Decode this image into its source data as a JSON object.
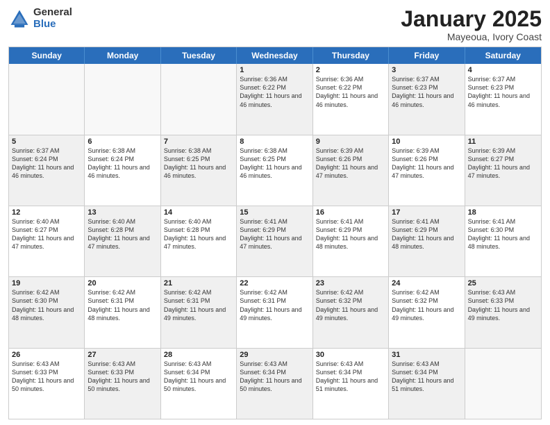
{
  "header": {
    "logo_general": "General",
    "logo_blue": "Blue",
    "title": "January 2025",
    "location": "Mayeoua, Ivory Coast"
  },
  "weekdays": [
    "Sunday",
    "Monday",
    "Tuesday",
    "Wednesday",
    "Thursday",
    "Friday",
    "Saturday"
  ],
  "rows": [
    [
      {
        "day": "",
        "info": "",
        "empty": true
      },
      {
        "day": "",
        "info": "",
        "empty": true
      },
      {
        "day": "",
        "info": "",
        "empty": true
      },
      {
        "day": "1",
        "info": "Sunrise: 6:36 AM\nSunset: 6:22 PM\nDaylight: 11 hours and 46 minutes.",
        "shaded": true
      },
      {
        "day": "2",
        "info": "Sunrise: 6:36 AM\nSunset: 6:22 PM\nDaylight: 11 hours and 46 minutes."
      },
      {
        "day": "3",
        "info": "Sunrise: 6:37 AM\nSunset: 6:23 PM\nDaylight: 11 hours and 46 minutes.",
        "shaded": true
      },
      {
        "day": "4",
        "info": "Sunrise: 6:37 AM\nSunset: 6:23 PM\nDaylight: 11 hours and 46 minutes."
      }
    ],
    [
      {
        "day": "5",
        "info": "Sunrise: 6:37 AM\nSunset: 6:24 PM\nDaylight: 11 hours and 46 minutes.",
        "shaded": true
      },
      {
        "day": "6",
        "info": "Sunrise: 6:38 AM\nSunset: 6:24 PM\nDaylight: 11 hours and 46 minutes."
      },
      {
        "day": "7",
        "info": "Sunrise: 6:38 AM\nSunset: 6:25 PM\nDaylight: 11 hours and 46 minutes.",
        "shaded": true
      },
      {
        "day": "8",
        "info": "Sunrise: 6:38 AM\nSunset: 6:25 PM\nDaylight: 11 hours and 46 minutes."
      },
      {
        "day": "9",
        "info": "Sunrise: 6:39 AM\nSunset: 6:26 PM\nDaylight: 11 hours and 47 minutes.",
        "shaded": true
      },
      {
        "day": "10",
        "info": "Sunrise: 6:39 AM\nSunset: 6:26 PM\nDaylight: 11 hours and 47 minutes."
      },
      {
        "day": "11",
        "info": "Sunrise: 6:39 AM\nSunset: 6:27 PM\nDaylight: 11 hours and 47 minutes.",
        "shaded": true
      }
    ],
    [
      {
        "day": "12",
        "info": "Sunrise: 6:40 AM\nSunset: 6:27 PM\nDaylight: 11 hours and 47 minutes."
      },
      {
        "day": "13",
        "info": "Sunrise: 6:40 AM\nSunset: 6:28 PM\nDaylight: 11 hours and 47 minutes.",
        "shaded": true
      },
      {
        "day": "14",
        "info": "Sunrise: 6:40 AM\nSunset: 6:28 PM\nDaylight: 11 hours and 47 minutes."
      },
      {
        "day": "15",
        "info": "Sunrise: 6:41 AM\nSunset: 6:29 PM\nDaylight: 11 hours and 47 minutes.",
        "shaded": true
      },
      {
        "day": "16",
        "info": "Sunrise: 6:41 AM\nSunset: 6:29 PM\nDaylight: 11 hours and 48 minutes."
      },
      {
        "day": "17",
        "info": "Sunrise: 6:41 AM\nSunset: 6:29 PM\nDaylight: 11 hours and 48 minutes.",
        "shaded": true
      },
      {
        "day": "18",
        "info": "Sunrise: 6:41 AM\nSunset: 6:30 PM\nDaylight: 11 hours and 48 minutes."
      }
    ],
    [
      {
        "day": "19",
        "info": "Sunrise: 6:42 AM\nSunset: 6:30 PM\nDaylight: 11 hours and 48 minutes.",
        "shaded": true
      },
      {
        "day": "20",
        "info": "Sunrise: 6:42 AM\nSunset: 6:31 PM\nDaylight: 11 hours and 48 minutes."
      },
      {
        "day": "21",
        "info": "Sunrise: 6:42 AM\nSunset: 6:31 PM\nDaylight: 11 hours and 49 minutes.",
        "shaded": true
      },
      {
        "day": "22",
        "info": "Sunrise: 6:42 AM\nSunset: 6:31 PM\nDaylight: 11 hours and 49 minutes."
      },
      {
        "day": "23",
        "info": "Sunrise: 6:42 AM\nSunset: 6:32 PM\nDaylight: 11 hours and 49 minutes.",
        "shaded": true
      },
      {
        "day": "24",
        "info": "Sunrise: 6:42 AM\nSunset: 6:32 PM\nDaylight: 11 hours and 49 minutes."
      },
      {
        "day": "25",
        "info": "Sunrise: 6:43 AM\nSunset: 6:33 PM\nDaylight: 11 hours and 49 minutes.",
        "shaded": true
      }
    ],
    [
      {
        "day": "26",
        "info": "Sunrise: 6:43 AM\nSunset: 6:33 PM\nDaylight: 11 hours and 50 minutes."
      },
      {
        "day": "27",
        "info": "Sunrise: 6:43 AM\nSunset: 6:33 PM\nDaylight: 11 hours and 50 minutes.",
        "shaded": true
      },
      {
        "day": "28",
        "info": "Sunrise: 6:43 AM\nSunset: 6:34 PM\nDaylight: 11 hours and 50 minutes."
      },
      {
        "day": "29",
        "info": "Sunrise: 6:43 AM\nSunset: 6:34 PM\nDaylight: 11 hours and 50 minutes.",
        "shaded": true
      },
      {
        "day": "30",
        "info": "Sunrise: 6:43 AM\nSunset: 6:34 PM\nDaylight: 11 hours and 51 minutes."
      },
      {
        "day": "31",
        "info": "Sunrise: 6:43 AM\nSunset: 6:34 PM\nDaylight: 11 hours and 51 minutes.",
        "shaded": true
      },
      {
        "day": "",
        "info": "",
        "empty": true
      }
    ]
  ]
}
